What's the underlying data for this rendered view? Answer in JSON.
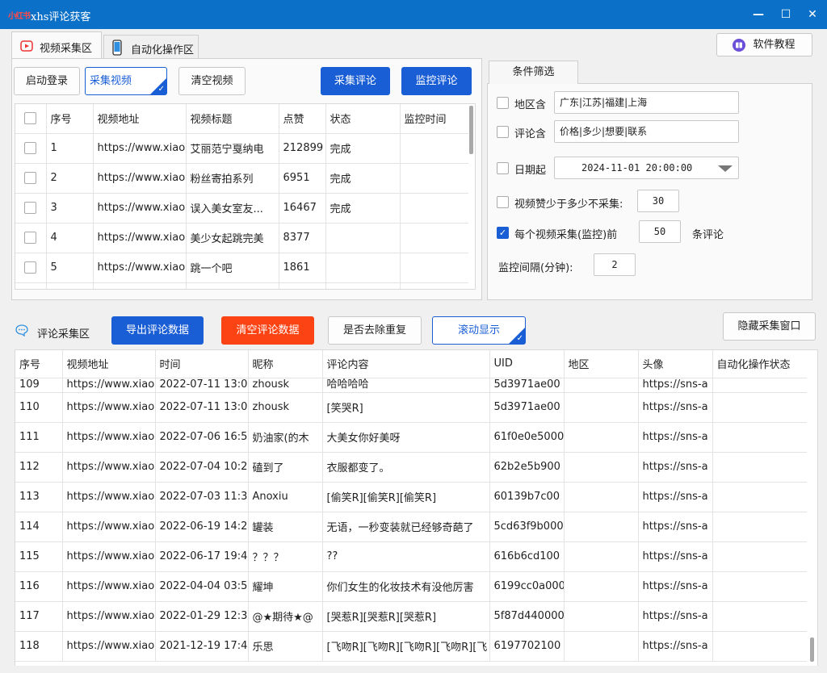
{
  "window": {
    "logo": "小红书",
    "title": "xhs评论获客",
    "min": "—",
    "max": "☐",
    "close": "✕"
  },
  "tabs": {
    "video": "视频采集区",
    "auto": "自动化操作区"
  },
  "help_button": "软件教程",
  "toolbar": {
    "login": "启动登录",
    "collect_video": "采集视频",
    "clear_video": "清空视频",
    "collect_comments": "采集评论",
    "monitor_comments": "监控评论"
  },
  "video_table": {
    "headers": [
      "序号",
      "视频地址",
      "视频标题",
      "点赞",
      "状态",
      "监控时间"
    ],
    "rows": [
      [
        "1",
        "https://www.xiao",
        "艾丽范宁戛纳电",
        "212899",
        "完成",
        ""
      ],
      [
        "2",
        "https://www.xiao",
        "粉丝寄拍系列",
        "6951",
        "完成",
        ""
      ],
      [
        "3",
        "https://www.xiao",
        "误入美女室友...",
        "16467",
        "完成",
        ""
      ],
      [
        "4",
        "https://www.xiao",
        "美少女起跳完美",
        "8377",
        "",
        ""
      ],
      [
        "5",
        "https://www.xiao",
        "跳一个吧",
        "1861",
        "",
        ""
      ]
    ]
  },
  "filters": {
    "tab": "条件筛选",
    "region_label": "地区含",
    "region_value": "广东|江苏|福建|上海",
    "comment_label": "评论含",
    "comment_value": "价格|多少|想要|联系",
    "date_label": "日期起",
    "date_value": "2024-11-01 20:00:00",
    "min_likes_label": "视频赞少于多少不采集:",
    "min_likes_value": "30",
    "per_video_label": "每个视频采集(监控)前",
    "per_video_value": "50",
    "per_video_suffix": "条评论",
    "interval_label": "监控间隔(分钟):",
    "interval_value": "2"
  },
  "comment_section": {
    "label": "评论采集区",
    "export": "导出评论数据",
    "clear": "清空评论数据",
    "dedupe": "是否去除重复",
    "scroll": "滚动显示",
    "hide_window": "隐藏采集窗口"
  },
  "comment_table": {
    "headers": [
      "序号",
      "视频地址",
      "时间",
      "昵称",
      "评论内容",
      "UID",
      "地区",
      "头像",
      "自动化操作状态"
    ],
    "rows": [
      [
        "109",
        "https://www.xiao",
        "2022-07-11 13:0",
        "zhousk",
        "哈哈哈哈",
        "5d3971ae00",
        "",
        "https://sns-a",
        ""
      ],
      [
        "110",
        "https://www.xiao",
        "2022-07-11 13:0",
        "zhousk",
        "[笑哭R]",
        "5d3971ae00",
        "",
        "https://sns-a",
        ""
      ],
      [
        "111",
        "https://www.xiao",
        "2022-07-06 16:5",
        "奶油家(的木",
        "大美女你好美呀",
        "61f0e0e5000",
        "",
        "https://sns-a",
        ""
      ],
      [
        "112",
        "https://www.xiao",
        "2022-07-04 10:2",
        "磕到了",
        "衣服都变了。",
        "62b2e5b900",
        "",
        "https://sns-a",
        ""
      ],
      [
        "113",
        "https://www.xiao",
        "2022-07-03 11:3",
        "Anoxiu",
        "[偷笑R][偷笑R][偷笑R]",
        "60139b7c00",
        "",
        "https://sns-a",
        ""
      ],
      [
        "114",
        "https://www.xiao",
        "2022-06-19 14:2",
        "罐装",
        "无语，一秒变装就已经够奇葩了",
        "5cd63f9b000",
        "",
        "https://sns-a",
        ""
      ],
      [
        "115",
        "https://www.xiao",
        "2022-06-17 19:4",
        "？？？",
        "??",
        "616b6cd100",
        "",
        "https://sns-a",
        ""
      ],
      [
        "116",
        "https://www.xiao",
        "2022-04-04 03:5",
        "耀坤",
        "你们女生的化妆技术有没他厉害",
        "6199cc0a000",
        "",
        "https://sns-a",
        ""
      ],
      [
        "117",
        "https://www.xiao",
        "2022-01-29 12:3",
        "@★期待★@",
        "[哭惹R][哭惹R][哭惹R]",
        "5f87d440000",
        "",
        "https://sns-a",
        ""
      ],
      [
        "118",
        "https://www.xiao",
        "2021-12-19 17:4",
        "乐思",
        "[飞吻R][飞吻R][飞吻R][飞吻R][飞",
        "6197702100",
        "",
        "https://sns-a",
        ""
      ]
    ]
  }
}
